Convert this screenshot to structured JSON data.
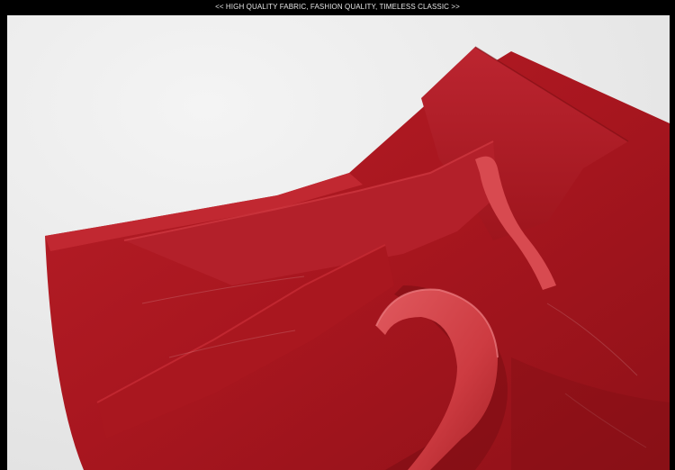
{
  "banner": {
    "text": "<< HIGH QUALITY FABRIC, FASHION QUALITY, TIMELESS CLASSIC >>"
  },
  "photo": {
    "subject": "red-suede-skirt-with-ruffle",
    "colors": {
      "background": "#eeeeee",
      "fabric": "#b01c24",
      "fabric_dark": "#8c1119",
      "fabric_light": "#c6353d",
      "ruffle_inner": "#d8474d"
    }
  }
}
